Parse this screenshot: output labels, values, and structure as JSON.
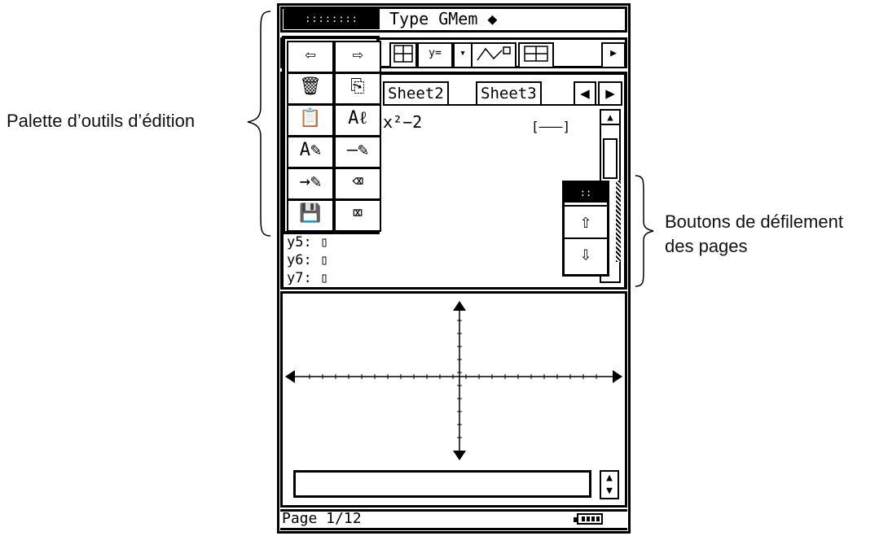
{
  "annotations": {
    "left_label": "Palette d’outils d’édition",
    "right_label_line1": "Boutons de défilement",
    "right_label_line2": "des pages"
  },
  "menubar": {
    "menu_icon": "::::::::",
    "title": "Type GMem ◆"
  },
  "toolbar": {
    "buttons": [
      "y=",
      "▾",
      "▶"
    ]
  },
  "editor": {
    "tabs": [
      "Sheet2",
      "Sheet3"
    ],
    "tab_arrows": [
      "◀",
      "▶"
    ],
    "expression": "x²−2",
    "range_marker": "[———]",
    "y_rows": [
      "y5: ▯",
      "y6: ▯",
      "y7: ▯"
    ]
  },
  "palette": {
    "items": [
      {
        "icon": "undo-arrow-icon",
        "glyph": "⇦"
      },
      {
        "icon": "redo-arrow-icon",
        "glyph": "⇨"
      },
      {
        "icon": "trash-icon",
        "glyph": "🗑"
      },
      {
        "icon": "copy-icon",
        "glyph": "⎘"
      },
      {
        "icon": "paste-icon",
        "glyph": "📋"
      },
      {
        "icon": "edit-text-icon",
        "glyph": "Aℓ"
      },
      {
        "icon": "text-style-icon",
        "glyph": "A✎"
      },
      {
        "icon": "line-style-icon",
        "glyph": "—✎"
      },
      {
        "icon": "arrow-style-icon",
        "glyph": "→✎"
      },
      {
        "icon": "eraser-icon",
        "glyph": "⌫"
      },
      {
        "icon": "save-icon",
        "glyph": "💾"
      },
      {
        "icon": "clear-all-icon",
        "glyph": "⌧"
      }
    ]
  },
  "page_scroll": {
    "header_icon": "::",
    "up_glyph": "⇧",
    "down_glyph": "⇩"
  },
  "input_bar": {
    "value": "",
    "updown_glyph": "±"
  },
  "status_bar": {
    "text": "Page 1/12"
  }
}
